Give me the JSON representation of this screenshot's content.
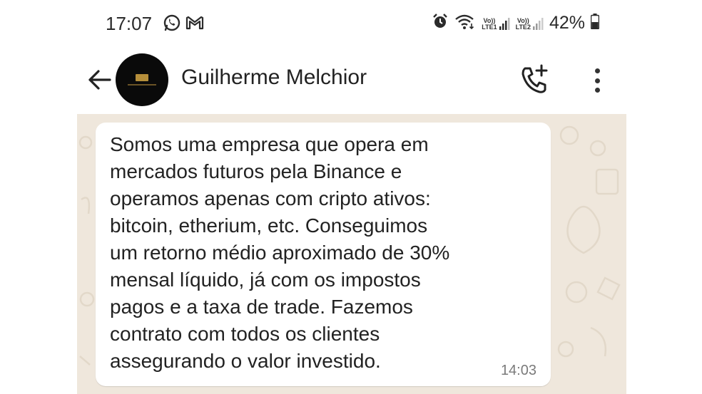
{
  "status_bar": {
    "time": "17:07",
    "left_icons": [
      "whatsapp-icon",
      "gmail-icon"
    ],
    "right_icons": [
      "alarm-icon",
      "wifi-icon",
      "signal-lte1-icon",
      "signal-lte2-icon",
      "battery-icon"
    ],
    "lte1_top": "Vo))",
    "lte1_bottom": "LTE1",
    "lte2_top": "Vo))",
    "lte2_bottom": "LTE2",
    "battery": "42%"
  },
  "header": {
    "contact_name": "Guilherme Melchior",
    "icons": [
      "back-arrow-icon",
      "avatar",
      "add-call-icon",
      "more-vert-icon"
    ]
  },
  "message": {
    "text": "Somos uma empresa que opera em\nmercados futuros pela Binance e\noperamos apenas com cripto ativos:\nbitcoin, etherium, etc. Conseguimos\num retorno médio aproximado de 30%\nmensal líquido, já com os impostos\npagos e a taxa de trade. Fazemos\ncontrato com todos os clientes\nassegurando o valor investido.",
    "time": "14:03"
  },
  "colors": {
    "chat_background": "#efe7dc",
    "bubble": "#ffffff",
    "text": "#222222",
    "timestamp": "#7a7a7a"
  }
}
